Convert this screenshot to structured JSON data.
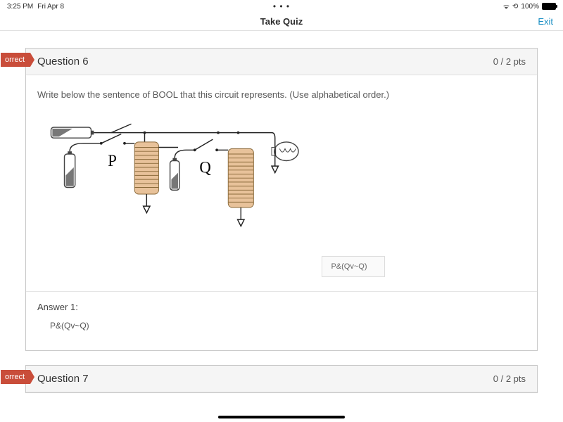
{
  "status": {
    "time": "3:25 PM",
    "date": "Fri Apr 8",
    "dots": "• • •",
    "wifi": "ᯤ",
    "orientation_lock": "⟲",
    "battery_pct": "100%"
  },
  "nav": {
    "title": "Take Quiz",
    "exit": "Exit"
  },
  "q6": {
    "flag": "orrect",
    "title": "Question 6",
    "pts": "0 / 2 pts",
    "prompt": "Write below the sentence of BOOL that this circuit represents. (Use alphabetical order.)",
    "labelP": "P",
    "labelQ": "Q",
    "input_value": "P&(Qv~Q)",
    "answer_label": "Answer 1:",
    "answer_value": "P&(Qv~Q)"
  },
  "q7": {
    "flag": "orrect",
    "title": "Question 7",
    "pts": "0 / 2 pts"
  }
}
